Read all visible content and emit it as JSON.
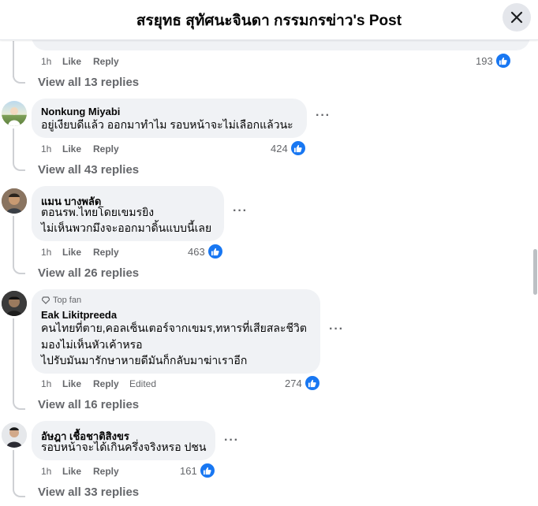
{
  "header": {
    "title": "สรยุทธ สุทัศนะจินดา กรรมกรข่าว's Post"
  },
  "top_comment": {
    "time": "1h",
    "like_label": "Like",
    "reply_label": "Reply",
    "likes": "193",
    "view_replies": "View all 13 replies"
  },
  "comments": [
    {
      "author": "Nonkung Miyabi",
      "lines": [
        "อยู่เงียบดีแล้ว ออกมาทำไม รอบหน้าจะไม่เลือกแล้วนะ"
      ],
      "time": "1h",
      "like_label": "Like",
      "reply_label": "Reply",
      "likes": "424",
      "view_replies": "View all 43 replies"
    },
    {
      "author": "แมน บางพลัด",
      "lines": [
        "ตอนรพ.ไทยโดยเขมรยิง",
        "ไม่เห็นพวกมึงจะออกมาดิ้นแบบนี้เลย"
      ],
      "time": "1h",
      "like_label": "Like",
      "reply_label": "Reply",
      "likes": "463",
      "view_replies": "View all 26 replies"
    },
    {
      "badge": "Top fan",
      "author": "Eak Likitpreeda",
      "lines": [
        "คนไทยที่ตาย,คอลเซ็นเตอร์จากเขมร,ทหารที่เสียสละชีวิต",
        "มองไม่เห็นหัวเค้าหรอ",
        "ไปรับมันมารักษาหายดีมันก็กลับมาฆ่าเราอีก"
      ],
      "time": "1h",
      "like_label": "Like",
      "reply_label": "Reply",
      "edited_label": "Edited",
      "likes": "274",
      "view_replies": "View all 16 replies"
    },
    {
      "author": "อัษฎา เชื้อชาติสิงขร",
      "lines": [
        "รอบหน้าจะได้เกินครึ่งจริงหรอ ปชน"
      ],
      "time": "1h",
      "like_label": "Like",
      "reply_label": "Reply",
      "likes": "161",
      "view_replies": "View all 33 replies"
    }
  ],
  "icons": {
    "close": "close-icon",
    "like": "like-thumb-icon",
    "more": "more-options-icon",
    "top_fan": "diamond-icon"
  },
  "colors": {
    "like_blue": "#1877f2",
    "bubble_bg": "#f0f2f5",
    "meta_gray": "#65676b"
  }
}
